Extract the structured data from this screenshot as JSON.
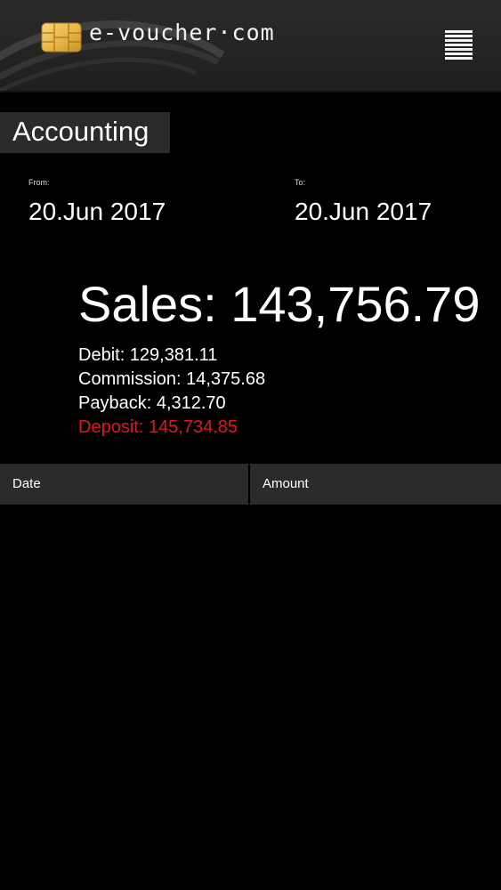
{
  "header": {
    "logo_text": "e-voucher·com",
    "logo_icon": "chip-card-icon",
    "menu_icon": "hamburger-menu-icon"
  },
  "page": {
    "title": "Accounting"
  },
  "date_range": {
    "from_label": "From:",
    "from_value": "20.Jun 2017",
    "to_label": "To:",
    "to_value": "20.Jun 2017"
  },
  "totals": {
    "sales": "Sales: 143,756.79",
    "debit": "Debit: 129,381.11",
    "commission": "Commission: 14,375.68",
    "payback": "Payback: 4,312.70",
    "deposit": "Deposit: 145,734.85"
  },
  "table": {
    "columns": [
      "Date",
      "Amount"
    ],
    "rows": []
  },
  "colors": {
    "background": "#000000",
    "panel": "#2b2b2b",
    "deposit": "#e0161f",
    "chip_gold": "#e9b949"
  }
}
